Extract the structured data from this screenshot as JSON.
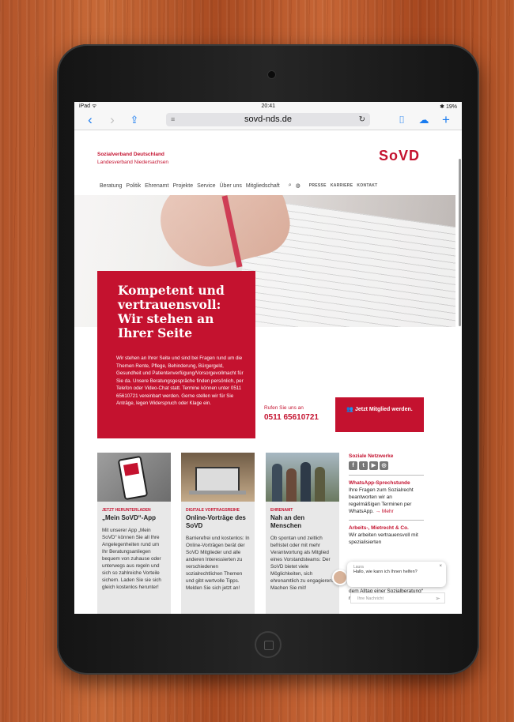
{
  "status_bar": {
    "left": "iPad ᯤ",
    "time": "20:41",
    "battery": "✱ 19%"
  },
  "browser": {
    "url": "sovd-nds.de",
    "reader_icon": "≡",
    "reload_icon": "↻"
  },
  "site": {
    "org_line1": "Sozialverband Deutschland",
    "org_line2": "Landesverband Niedersachsen",
    "logo": "SoVD",
    "nav": [
      "Beratung",
      "Politik",
      "Ehrenamt",
      "Projekte",
      "Service",
      "Über uns",
      "Mitgliedschaft"
    ],
    "nav_right": [
      "PRESSE",
      "KARRIERE",
      "KONTAKT"
    ]
  },
  "hero": {
    "heading": "Kompetent und vertrauensvoll: Wir stehen an Ihrer Seite",
    "text": "Wir stehen an Ihrer Seite und sind bei Fragen rund um die Themen Rente, Pflege, Behinderung, Bürgergeld, Gesundheit und Patientenverfügung/Vorsorgevollmacht für Sie da. Unsere Beratungsgespräche finden persönlich, per Telefon oder Video-Chat statt. Termine können unter 0511 65610721 vereinbart werden. Gerne stellen wir für Sie Anträge, legen Widerspruch oder Klage ein.",
    "call_label": "Rufen Sie uns an",
    "call_number": "0511 65610721",
    "member_button": "Jetzt Mitglied werden."
  },
  "cards": [
    {
      "tag": "JETZT HERUNTERLADEN",
      "title": "„Mein SoVD“-App",
      "text": "Mit unserer App „Mein SoVD“ können Sie all Ihre Angelegenheiten rund um Ihr Beratungsanliegen bequem von zuhause oder unterwegs aus regeln und sich so zahlreiche Vorteile sichern. Laden Sie sie sich gleich kostenlos herunter!"
    },
    {
      "tag": "DIGITALE VORTRAGSREIHE",
      "title": "Online-Vorträge des SoVD",
      "text": "Barrierefrei und kostenlos: In Online-Vorträgen berät der SoVD Mitglieder und alle anderen Interessierten zu verschiedenen sozialrechtlichen Themen und gibt wertvolle Tipps. Melden Sie sich jetzt an!"
    },
    {
      "tag": "EHRENAMT",
      "title": "Nah an den Menschen",
      "text": "Ob spontan und zeitlich befristet oder mit mehr Verantwortung als Mitglied eines Vorstandsteams: Der SoVD bietet viele Möglichkeiten, sich ehrenamtlich zu engagieren. Machen Sie mit!"
    }
  ],
  "sidebar": {
    "social_heading": "Soziale Netzwerke",
    "whatsapp_heading": "WhatsApp-Sprechstunde",
    "whatsapp_text": "Ihre Fragen zum Sozialrecht beantworten wir an regelmäßigen Terminen per WhatsApp.",
    "more": "→ Mehr",
    "arbeits_heading": "Arbeits-, Mietrecht & Co.",
    "arbeits_text": "Wir arbeiten vertrauensvoll mit spezialisierten",
    "podcast_text": "Podcast „Kein Ponyhof - aus dem Alltag einer Sozialberatung“ rein."
  },
  "chat": {
    "name": "Laura",
    "message": "Hallo, wie kann ich Ihnen helfen?",
    "input_placeholder": "Ihre Nachricht"
  },
  "colors": {
    "brand_red": "#c4122f",
    "link_blue": "#1a7cf0"
  }
}
